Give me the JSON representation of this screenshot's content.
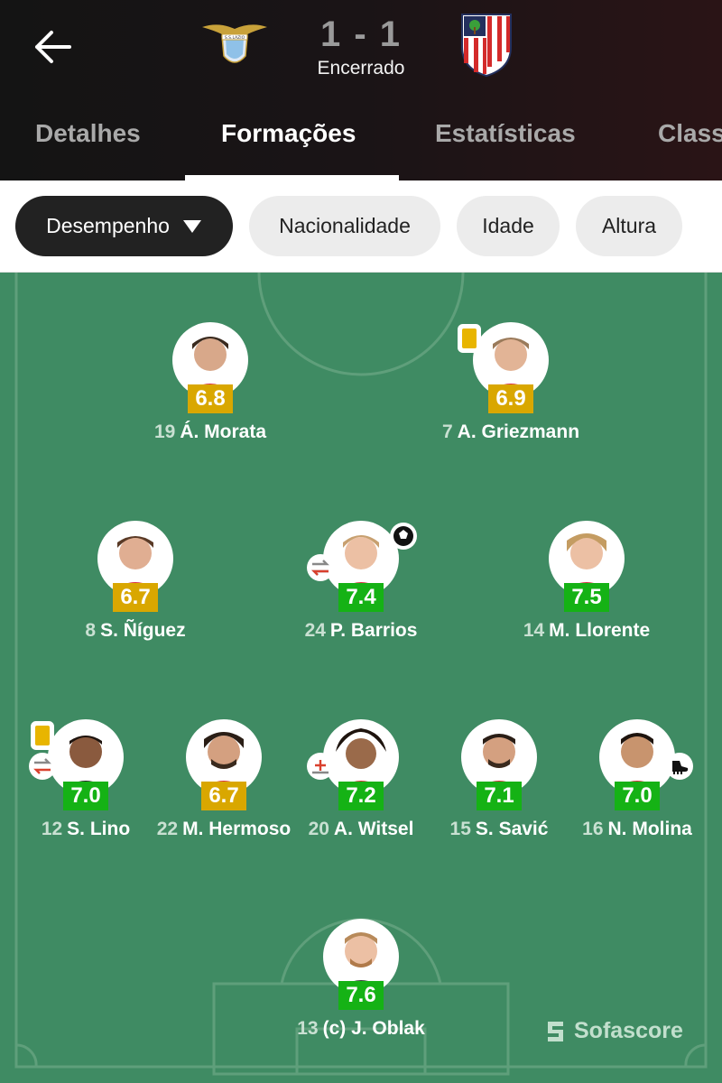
{
  "header": {
    "home_crest_name": "S.S.LAZIO",
    "score": "1 - 1",
    "status": "Encerrado"
  },
  "tabs": [
    {
      "label": "Detalhes",
      "active": false
    },
    {
      "label": "Formações",
      "active": true
    },
    {
      "label": "Estatísticas",
      "active": false
    },
    {
      "label": "Class",
      "active": false
    }
  ],
  "filters": [
    {
      "label": "Desempenho",
      "active": true,
      "icon": "caret-down-icon"
    },
    {
      "label": "Nacionalidade",
      "active": false
    },
    {
      "label": "Idade",
      "active": false
    },
    {
      "label": "Altura",
      "active": false
    }
  ],
  "players": [
    {
      "number": "19",
      "name": "Á. Morata",
      "rating": "6.8",
      "rating_color": "yellow"
    },
    {
      "number": "7",
      "name": "A. Griezmann",
      "rating": "6.9",
      "rating_color": "yellow",
      "yellow_card": true
    },
    {
      "number": "8",
      "name": "S. Ñíguez",
      "rating": "6.7",
      "rating_color": "yellow"
    },
    {
      "number": "24",
      "name": "P. Barrios",
      "rating": "7.4",
      "rating_color": "green",
      "goal": true,
      "substituted": true
    },
    {
      "number": "14",
      "name": "M. Llorente",
      "rating": "7.5",
      "rating_color": "green"
    },
    {
      "number": "12",
      "name": "S. Lino",
      "rating": "7.0",
      "rating_color": "green",
      "yellow_card": true,
      "substituted": true
    },
    {
      "number": "22",
      "name": "M. Hermoso",
      "rating": "6.7",
      "rating_color": "yellow"
    },
    {
      "number": "20",
      "name": "A. Witsel",
      "rating": "7.2",
      "rating_color": "green",
      "sub_in": true
    },
    {
      "number": "15",
      "name": "S. Savić",
      "rating": "7.1",
      "rating_color": "green"
    },
    {
      "number": "16",
      "name": "N. Molina",
      "rating": "7.0",
      "rating_color": "green",
      "assist": true
    },
    {
      "number": "13",
      "name": "(c) J. Oblak",
      "rating": "7.6",
      "rating_color": "green"
    }
  ],
  "watermark": "Sofascore",
  "colors": {
    "pitch": "#3f8b63",
    "rating_green": "#15b215",
    "rating_yellow": "#d9a700",
    "header_bg": "#141414"
  }
}
